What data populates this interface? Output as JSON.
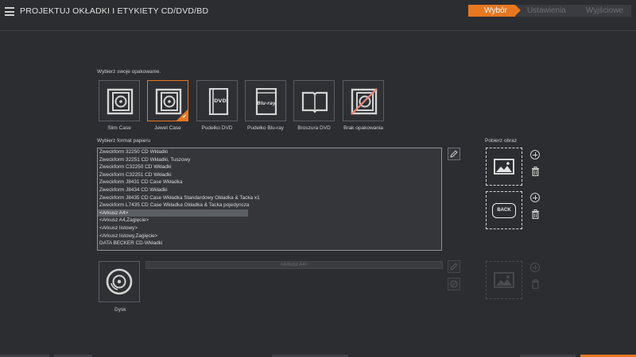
{
  "app": {
    "title": "PROJEKTUJ OKŁADKI I ETYKIETY CD/DVD/BD"
  },
  "steps": [
    {
      "label": "Wybór",
      "active": true
    },
    {
      "label": "Ustawienia",
      "active": false
    },
    {
      "label": "Wyjściowe",
      "active": false
    }
  ],
  "packaging": {
    "heading": "Wybierz swoje opakowanie.",
    "items": [
      {
        "label": "Slim Case",
        "icon": "slim-case-icon",
        "selected": false
      },
      {
        "label": "Jewel Case",
        "icon": "jewel-case-icon",
        "selected": true
      },
      {
        "label": "Pudełko DVD",
        "icon": "dvd-box-icon",
        "selected": false,
        "icon_text": "DVD"
      },
      {
        "label": "Pudełko Blu-ray",
        "icon": "bluray-box-icon",
        "selected": false,
        "icon_text": "Blu-ray"
      },
      {
        "label": "Broszura DVD",
        "icon": "booklet-icon",
        "selected": false
      },
      {
        "label": "Brak opakowania",
        "icon": "no-packaging-icon",
        "selected": false
      }
    ]
  },
  "paper": {
    "heading": "Wybierz format papieru",
    "items": [
      "Zweckform 32250 CD Wkładki",
      "Zweckform 32251 CD Wkładki, Tuszowy",
      "Zweckform C32250 CD Wkładki",
      "Zweckform C32251 CD Wkładki",
      "Zweckform J8431 CD Case Wkładka",
      "Zweckform J8434 CD Wkładki",
      "Zweckform J8435 CD Case Wkładka Standardowy Okładka & Tacka x1",
      "Zweckform L7435 CD Case Wkładka Okładka & Tacka pojedyncza",
      "<Arkusz A4>",
      "<Arkusz A4,Zagięcie>",
      "<Arkusz listowy>",
      "<Arkusz listowy,Zagięcie>",
      "DATA BECKER CD-Wkładki"
    ],
    "selected_index": 8
  },
  "image": {
    "heading": "Pobierz obraz",
    "back_label": "BACK"
  },
  "disc": {
    "label": "Dysk",
    "paper_value": "<Arkusz A4>"
  },
  "colors": {
    "accent": "#e87722",
    "background": "#2b2d31"
  }
}
